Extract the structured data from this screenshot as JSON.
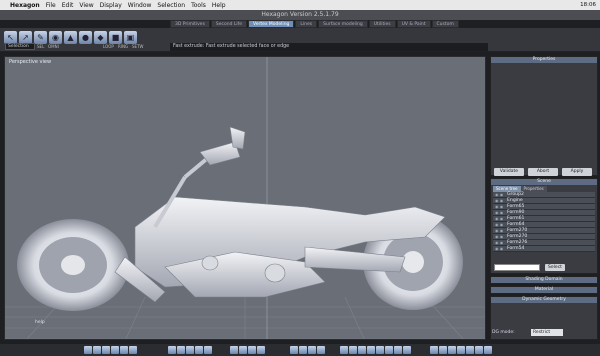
{
  "menubar": {
    "app_label": "Hexagon",
    "items": [
      "File",
      "Edit",
      "View",
      "Display",
      "Window",
      "Selection",
      "Tools",
      "Help"
    ],
    "clock": "18:06"
  },
  "window": {
    "title": "Hexagon Version 2.5.1.79"
  },
  "toolbar": {
    "tabs": [
      "3D Primitives",
      "Second Life",
      "Vertex Modeling",
      "Lines",
      "Surface modeling",
      "Utilities",
      "UV & Paint",
      "Custom"
    ],
    "active_tab": "Vertex Modeling",
    "selection_label": "Selection",
    "left_small": [
      "SEL",
      "OMNI"
    ],
    "mid_small": [
      "LOOP",
      "RING",
      "SETW"
    ],
    "status_text": "Fast extrude: Fast extrude selected face or edge"
  },
  "viewport": {
    "label": "Perspective view",
    "help": "help"
  },
  "properties": {
    "header": "Properties",
    "buttons": [
      "Validate",
      "Abort",
      "Apply"
    ]
  },
  "scene": {
    "header": "Scene",
    "tabs": [
      "Scene tree",
      "Properties"
    ],
    "items": [
      "Group2",
      "Engine",
      "Form65",
      "Form90",
      "Form61",
      "Form64",
      "Form270",
      "Form270",
      "Form276",
      "Form54"
    ],
    "select_button": "Select"
  },
  "panels": {
    "shading": "Shading Domain",
    "material": "Material",
    "dynamic": "Dynamic Geometry",
    "dg_mode_label": "DG mode:",
    "dg_mode_value": "Restrict"
  }
}
